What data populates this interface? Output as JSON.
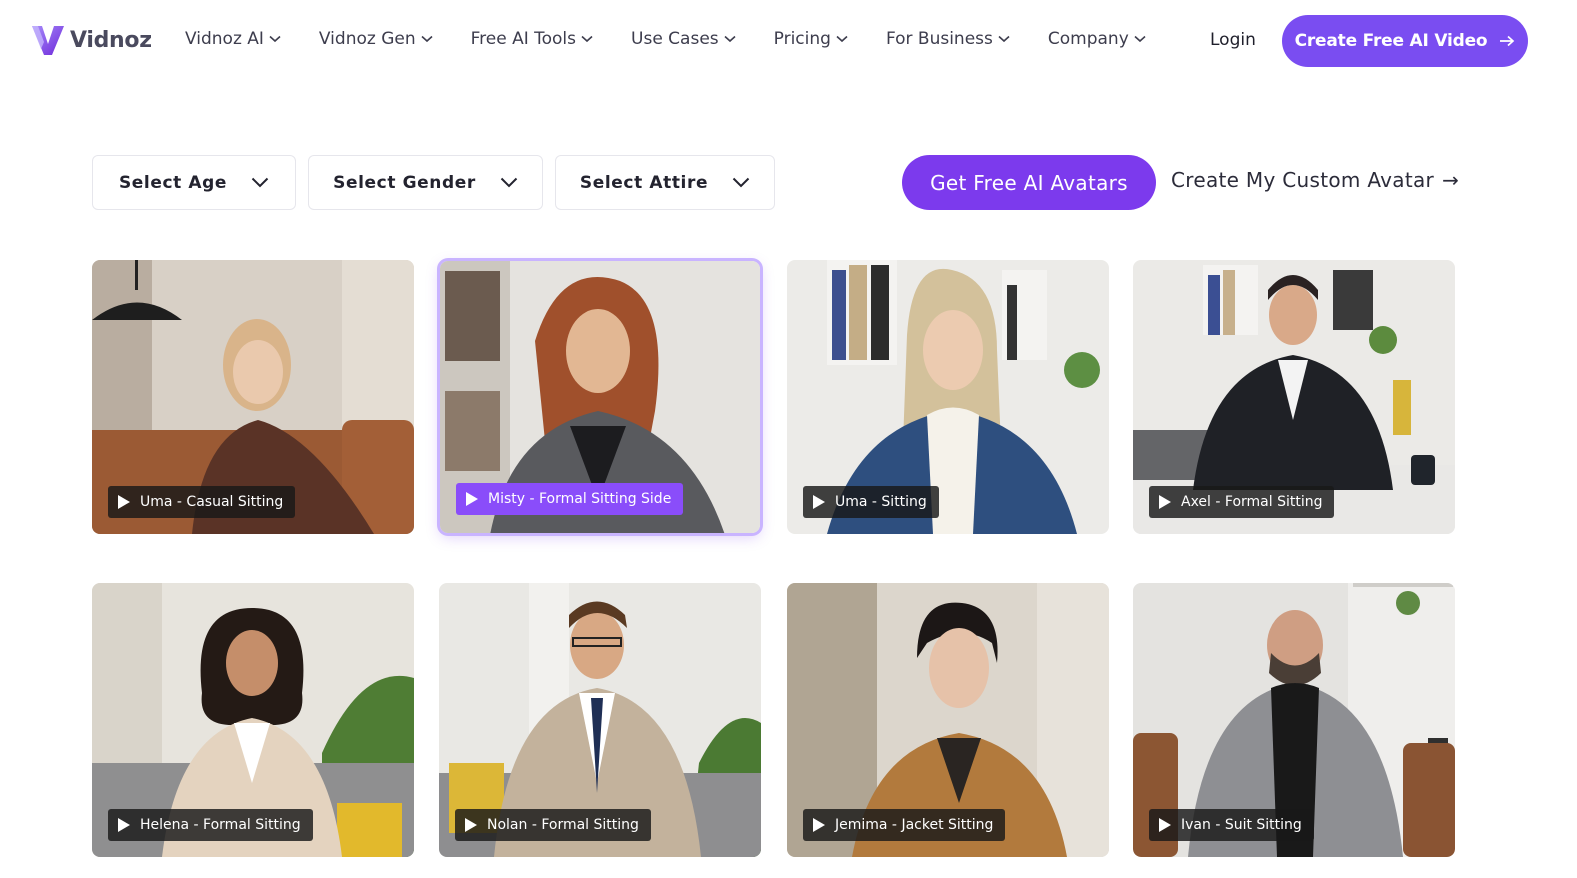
{
  "brand": {
    "name": "Vidnoz",
    "accent": "#7c3aed",
    "cta_color": "#7a4df1"
  },
  "nav": {
    "items": [
      {
        "label": "Vidnoz AI"
      },
      {
        "label": "Vidnoz Gen"
      },
      {
        "label": "Free AI Tools"
      },
      {
        "label": "Use Cases"
      },
      {
        "label": "Pricing"
      },
      {
        "label": "For Business"
      },
      {
        "label": "Company"
      }
    ],
    "login_label": "Login",
    "cta_label": "Create Free AI Video",
    "cta_icon": "arrow-right-icon"
  },
  "filters": {
    "age": "Select Age",
    "gender": "Select Gender",
    "attire": "Select Attire",
    "get_avatars_label": "Get Free AI Avatars",
    "custom_label": "Create My Custom Avatar",
    "custom_arrow": "→"
  },
  "avatars": [
    {
      "name": "Uma - Casual Sitting",
      "active": false
    },
    {
      "name": "Misty - Formal Sitting Side",
      "active": true
    },
    {
      "name": "Uma - Sitting",
      "active": false
    },
    {
      "name": "Axel - Formal Sitting",
      "active": false
    },
    {
      "name": "Helena - Formal Sitting",
      "active": false
    },
    {
      "name": "Nolan - Formal Sitting",
      "active": false
    },
    {
      "name": "Jemima - Jacket Sitting",
      "active": false
    },
    {
      "name": "Ivan - Suit Sitting",
      "active": false
    }
  ]
}
